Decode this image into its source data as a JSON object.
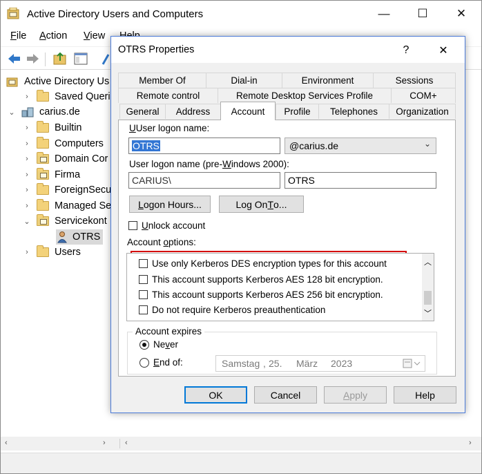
{
  "main_window": {
    "title": "Active Directory Users and Computers",
    "controls": {
      "minimize": "—",
      "maximize": "☐",
      "close": "✕"
    },
    "menu": [
      {
        "label": "File",
        "key": "F",
        "rest": "ile"
      },
      {
        "label": "Action",
        "key": "A",
        "rest": "ction"
      },
      {
        "label": "View",
        "key": "V",
        "rest": "iew"
      },
      {
        "label": "Help",
        "key": "H",
        "rest": "elp"
      }
    ],
    "tree": {
      "root": "Active Directory Us",
      "saved_queries": "Saved Queries",
      "domain": "carius.de",
      "items": [
        "Builtin",
        "Computers",
        "Domain Cor",
        "Firma",
        "ForeignSecu",
        "Managed Se",
        "Servicekont"
      ],
      "selected_user": "OTRS",
      "users": "Users"
    }
  },
  "dialog": {
    "title": "OTRS Properties",
    "help": "?",
    "close": "✕",
    "tabs_row1": [
      "Member Of",
      "Dial-in",
      "Environment",
      "Sessions"
    ],
    "tabs_row2": [
      "Remote control",
      "Remote Desktop Services Profile",
      "COM+"
    ],
    "tabs_row3": [
      "General",
      "Address",
      "Account",
      "Profile",
      "Telephones",
      "Organization"
    ],
    "active_tab": "Account",
    "account": {
      "logon_label": "User logon name:",
      "logon_value": "OTRS",
      "domain_suffix": "@carius.de",
      "pre2000_label_a": "User logon name (pre-",
      "pre2000_label_key": "W",
      "pre2000_label_b": "indows 2000):",
      "pre2000_domain": "CARIUS\\",
      "pre2000_user": "OTRS",
      "logon_hours_key": "L",
      "logon_hours_rest": "ogon Hours...",
      "logon_to_a": "Log On ",
      "logon_to_key": "T",
      "logon_to_b": "o...",
      "unlock_key": "U",
      "unlock_rest": "nlock account",
      "options_label_a": "Account ",
      "options_label_key": "o",
      "options_label_b": "ptions:",
      "options": [
        "Use only Kerberos DES encryption types for this account",
        "This account supports Kerberos AES 128 bit encryption.",
        "This account supports Kerberos AES 256 bit encryption.",
        "Do not require Kerberos preauthentication"
      ],
      "expires_legend": "Account expires",
      "never_a": "Ne",
      "never_key": "v",
      "never_b": "er",
      "endof_key": "E",
      "endof_rest": "nd of:",
      "date_day": "Samstag",
      "date_sep": ",",
      "date_num": "25.",
      "date_month": "März",
      "date_year": "2023"
    },
    "buttons": {
      "ok": "OK",
      "cancel": "Cancel",
      "apply_key": "A",
      "apply_rest": "pply",
      "help": "Help"
    }
  }
}
